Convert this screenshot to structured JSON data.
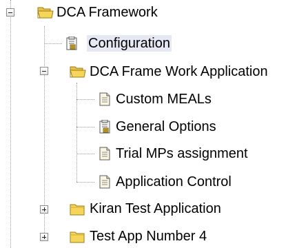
{
  "tree": {
    "root": {
      "label": "DCA Framework",
      "toggle": "minus",
      "icon": "folder-open-icon"
    },
    "root_children": [
      {
        "label": "Configuration",
        "icon": "settings-document-icon",
        "selected": true
      },
      {
        "label": "DCA Frame Work Application",
        "toggle": "minus",
        "icon": "folder-open-icon",
        "children": [
          {
            "label": "Custom MEALs",
            "icon": "document-icon"
          },
          {
            "label": "General Options",
            "icon": "settings-document-icon"
          },
          {
            "label": "Trial MPs assignment",
            "icon": "document-icon"
          },
          {
            "label": "Application Control",
            "icon": "document-icon"
          }
        ]
      },
      {
        "label": "Kiran Test Application",
        "toggle": "plus",
        "icon": "folder-closed-icon"
      },
      {
        "label": "Test App Number 4",
        "toggle": "plus",
        "icon": "folder-closed-icon"
      }
    ]
  },
  "colors": {
    "folder": "#f5d55a",
    "folder_edge": "#9b7c18",
    "selection": "#e6e8f4",
    "connector": "#9a9a9a"
  }
}
